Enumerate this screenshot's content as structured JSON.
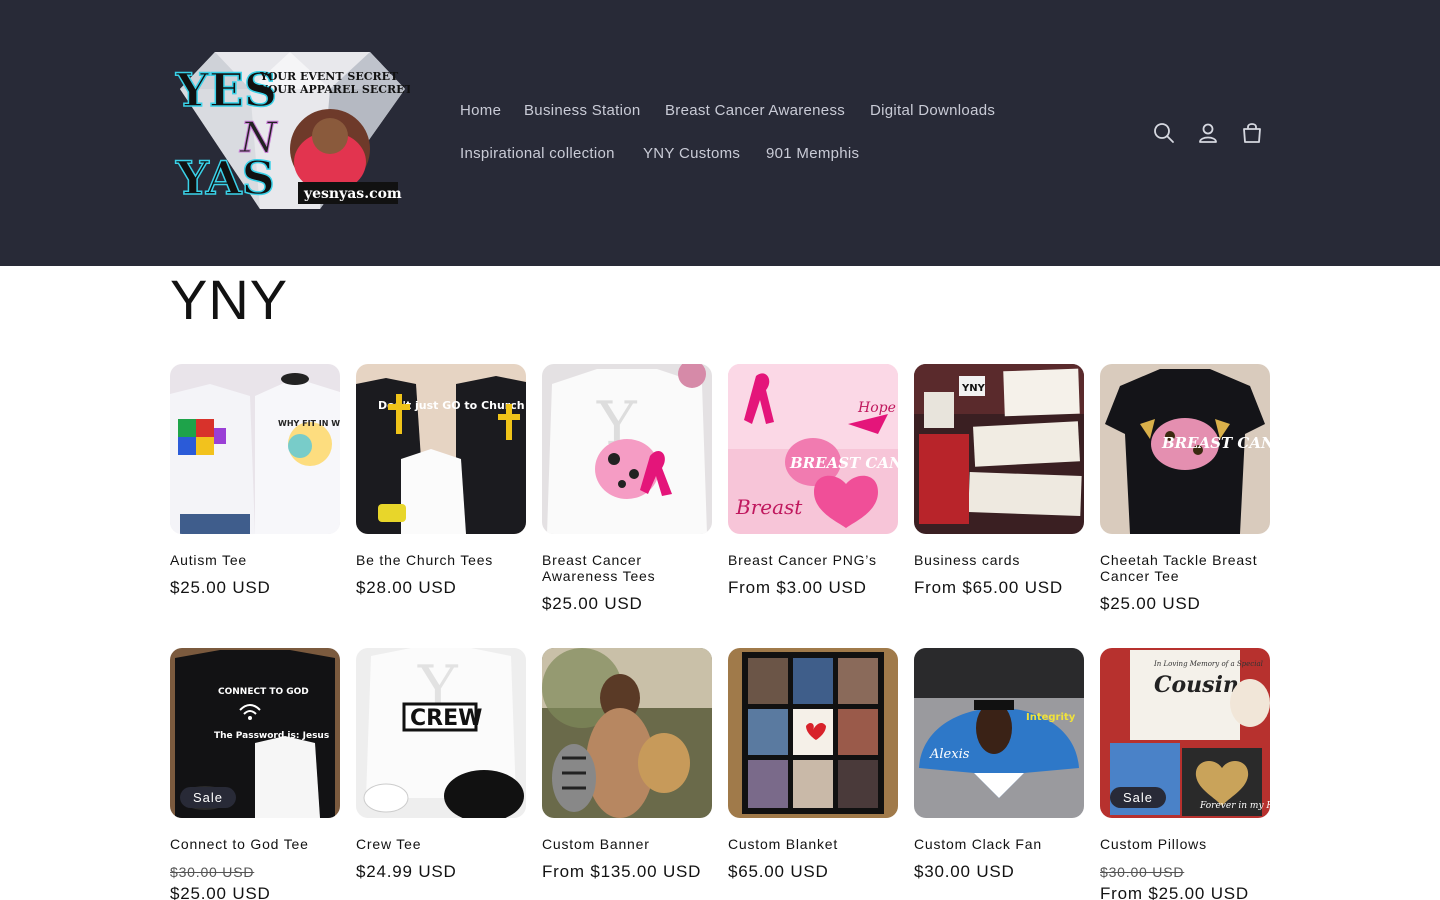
{
  "header": {
    "logo": {
      "line1": "YES",
      "line2": "N",
      "line3": "YAS",
      "tagline1": "YOUR EVENT SECRET",
      "tagline2": "YOUR APPAREL SECRET",
      "domain": "yesnyas.com"
    },
    "nav": [
      {
        "label": "Home"
      },
      {
        "label": "Business Station"
      },
      {
        "label": "Breast Cancer Awareness"
      },
      {
        "label": "Digital Downloads"
      },
      {
        "label": "Inspirational collection"
      },
      {
        "label": "YNY Customs"
      },
      {
        "label": "901 Memphis"
      }
    ],
    "icons": [
      "search-icon",
      "account-icon",
      "cart-icon"
    ]
  },
  "collection": {
    "title": "YNY"
  },
  "products": [
    {
      "title": "Autism Tee",
      "price": "$25.00 USD"
    },
    {
      "title": "Be the Church Tees",
      "price": "$28.00 USD"
    },
    {
      "title": "Breast Cancer Awareness Tees",
      "price": "$25.00 USD"
    },
    {
      "title": "Breast Cancer PNG’s",
      "price": "From $3.00 USD"
    },
    {
      "title": "Business cards",
      "price": "From $65.00 USD"
    },
    {
      "title": "Cheetah Tackle Breast Cancer Tee",
      "price": "$25.00 USD"
    },
    {
      "title": "Connect to God Tee",
      "badge": "Sale",
      "compare_price": "$30.00 USD",
      "price": "$25.00 USD"
    },
    {
      "title": "Crew Tee",
      "price": "$24.99 USD"
    },
    {
      "title": "Custom Banner",
      "price": "From $135.00 USD"
    },
    {
      "title": "Custom Blanket",
      "price": "$65.00 USD"
    },
    {
      "title": "Custom Clack Fan",
      "price": "$30.00 USD"
    },
    {
      "title": "Custom Pillows",
      "badge": "Sale",
      "compare_price": "$30.00 USD",
      "price": "From $25.00 USD"
    }
  ],
  "image_text": {
    "autism": "WHY FIT IN WHEN YOU CAN STAND OUT!",
    "church": "Don't just GO to Church BE the Church",
    "breast": "BREAST CANCER",
    "hope": "Hope",
    "cards": "YNY",
    "connect": "CONNECT TO GOD",
    "password": "The Password is: Jesus",
    "crew": "CREW",
    "fan_name": "Alexis",
    "fan_word": "Integrity",
    "pillow": "Cousin",
    "pillow_memory": "In Loving Memory of a Special",
    "forever": "Forever in my Heart"
  },
  "colors": {
    "header_bg": "#282a37",
    "nav_text": "#c9cbd6",
    "badge_bg": "#282a37",
    "text": "#121212"
  }
}
